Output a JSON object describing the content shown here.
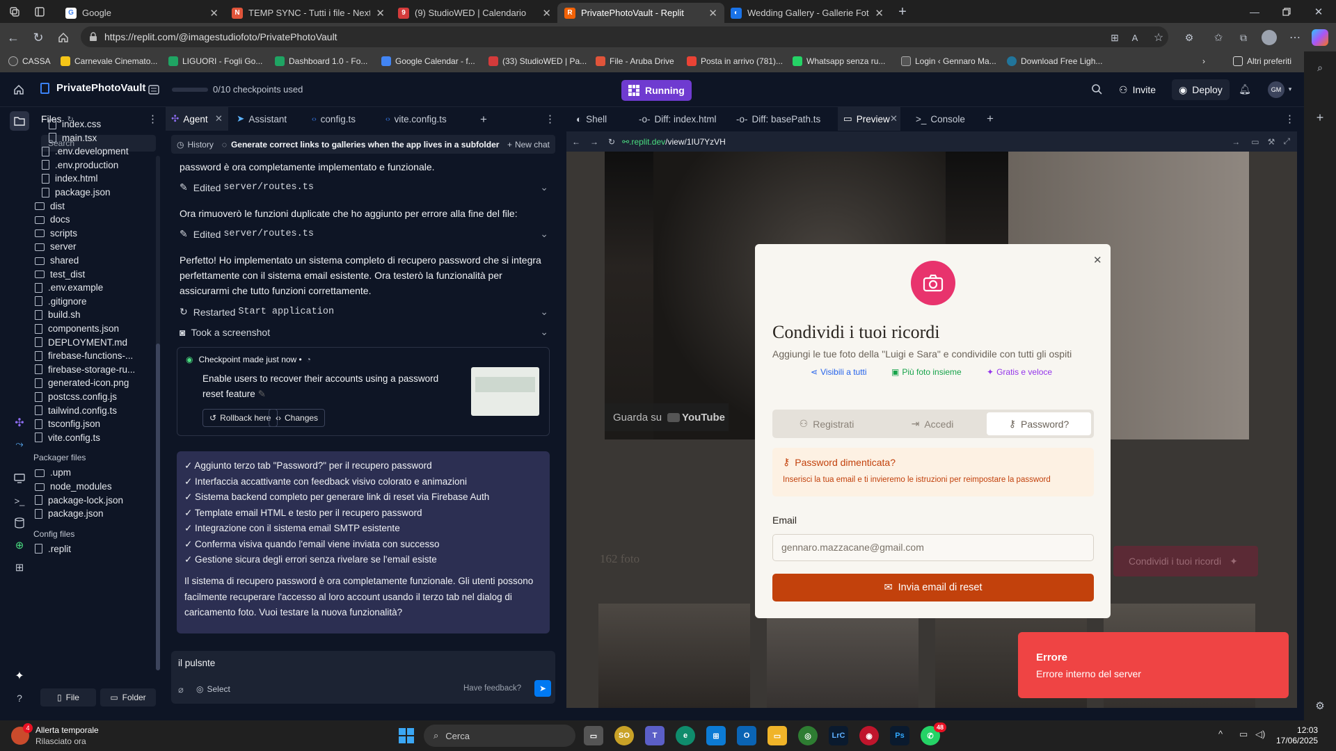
{
  "browser": {
    "tabs": [
      {
        "title": "Google",
        "active": false
      },
      {
        "title": "TEMP SYNC - Tutti i file - Nextclo",
        "active": false
      },
      {
        "title": "(9) StudioWED | Calendario",
        "active": false
      },
      {
        "title": "PrivatePhotoVault - Replit",
        "active": true
      },
      {
        "title": "Wedding Gallery - Gallerie Fotogr",
        "active": false
      }
    ],
    "url": "https://replit.com/@imagestudiofoto/PrivatePhotoVault",
    "bookmarks": [
      "CASSA",
      "Carnevale Cinemato...",
      "LIGUORI - Fogli Go...",
      "Dashboard 1.0 - Fo...",
      "Google Calendar - f...",
      "(33) StudioWED | Pa...",
      "File - Aruba Drive",
      "Posta in arrivo (781)...",
      "Whatsapp senza ru...",
      "Login ‹ Gennaro Ma...",
      "Download Free Ligh..."
    ],
    "bookmarks_other": "Altri preferiti"
  },
  "replit": {
    "project_name": "PrivatePhotoVault",
    "checkpoints": "0/10 checkpoints used",
    "run_status": "Running",
    "invite_label": "Invite",
    "deploy_label": "Deploy",
    "avatar_initials": "GM"
  },
  "files": {
    "title": "Files",
    "search_placeholder": "Search",
    "items": [
      {
        "name": "index.css",
        "type": "file",
        "indent": 2
      },
      {
        "name": "main.tsx",
        "type": "file",
        "indent": 2
      },
      {
        "name": ".env.development",
        "type": "file",
        "indent": 1
      },
      {
        "name": ".env.production",
        "type": "file",
        "indent": 1
      },
      {
        "name": "index.html",
        "type": "file",
        "indent": 1
      },
      {
        "name": "package.json",
        "type": "file",
        "indent": 1
      },
      {
        "name": "dist",
        "type": "folder",
        "indent": 0
      },
      {
        "name": "docs",
        "type": "folder",
        "indent": 0
      },
      {
        "name": "scripts",
        "type": "folder",
        "indent": 0
      },
      {
        "name": "server",
        "type": "folder",
        "indent": 0
      },
      {
        "name": "shared",
        "type": "folder",
        "indent": 0
      },
      {
        "name": "test_dist",
        "type": "folder",
        "indent": 0
      },
      {
        "name": ".env.example",
        "type": "file",
        "indent": 0
      },
      {
        "name": ".gitignore",
        "type": "file",
        "indent": 0
      },
      {
        "name": "build.sh",
        "type": "file",
        "indent": 0
      },
      {
        "name": "components.json",
        "type": "file",
        "indent": 0
      },
      {
        "name": "DEPLOYMENT.md",
        "type": "file",
        "indent": 0
      },
      {
        "name": "firebase-functions-...",
        "type": "file",
        "indent": 0
      },
      {
        "name": "firebase-storage-ru...",
        "type": "file",
        "indent": 0
      },
      {
        "name": "generated-icon.png",
        "type": "file",
        "indent": 0
      },
      {
        "name": "postcss.config.js",
        "type": "file",
        "indent": 0
      },
      {
        "name": "tailwind.config.ts",
        "type": "file",
        "indent": 0
      },
      {
        "name": "tsconfig.json",
        "type": "file",
        "indent": 0
      },
      {
        "name": "vite.config.ts",
        "type": "file",
        "indent": 0
      }
    ],
    "packager_title": "Packager files",
    "packager_items": [
      ".upm",
      "node_modules",
      "package-lock.json",
      "package.json"
    ],
    "config_title": "Config files",
    "config_items": [
      ".replit"
    ],
    "new_file": "File",
    "new_folder": "Folder"
  },
  "agent": {
    "tabs": [
      "Agent",
      "Assistant",
      "config.ts",
      "vite.config.ts"
    ],
    "history_label": "History",
    "chat_title": "Generate correct links to galleries when the app lives in a subfolder",
    "new_chat": "New chat",
    "msg0": "password è ora completamente implementato e funzionale.",
    "tool1": "Edited",
    "tool1_file": "server/routes.ts",
    "msg1": "Ora rimuoverò le funzioni duplicate che ho aggiunto per errore alla fine del file:",
    "tool2": "Edited",
    "tool2_file": "server/routes.ts",
    "msg2": "Perfetto! Ho implementato un sistema completo di recupero password che si integra perfettamente con il sistema email esistente. Ora testerò la funzionalità per assicurarmi che tutto funzioni correttamente.",
    "tool3": "Restarted",
    "tool3_file": "Start application",
    "tool4": "Took a screenshot",
    "checkpoint_header": "Checkpoint made just now •",
    "checkpoint_text": "Enable users to recover their accounts using a password reset feature",
    "rollback": "Rollback here",
    "changes": "Changes",
    "summary": [
      "✓ Aggiunto terzo tab \"Password?\" per il recupero password",
      "✓ Interfaccia accattivante con feedback visivo colorato e animazioni",
      "✓ Sistema backend completo per generare link di reset via Firebase Auth",
      "✓ Template email HTML e testo per il recupero password",
      "✓ Integrazione con il sistema email SMTP esistente",
      "✓ Conferma visiva quando l'email viene inviata con successo",
      "✓ Gestione sicura degli errori senza rivelare se l'email esiste"
    ],
    "summary_para": "Il sistema di recupero password è ora completamente funzionale. Gli utenti possono facilmente recuperare l'accesso al loro account usando il terzo tab nel dialog di caricamento foto. Vuoi testare la nuova funzionalità?",
    "input_value": "il pulsnte",
    "select_label": "Select",
    "feedback": "Have feedback?"
  },
  "preview": {
    "tabs": [
      "Shell",
      "Diff: index.html",
      "Diff: basePath.ts",
      "Preview",
      "Console"
    ],
    "url_prefix": ".replit.dev",
    "url_path": "/view/1IU7YzVH",
    "youtube_text": "Guarda su",
    "youtube_brand": "YouTube",
    "photo_count": "162 foto",
    "share_button": "Condividi i tuoi ricordi",
    "modal": {
      "title": "Condividi i tuoi ricordi",
      "subtitle": "Aggiungi le tue foto della \"Luigi e Sara\" e condividile con tutti gli ospiti",
      "features": [
        "Visibili a tutti",
        "Più foto insieme",
        "Gratis e veloce"
      ],
      "tabs": [
        "Registrati",
        "Accedi",
        "Password?"
      ],
      "info_title": "Password dimenticata?",
      "info_text": "Inserisci la tua email e ti invieremo le istruzioni per reimpostare la password",
      "email_label": "Email",
      "email_value": "gennaro.mazzacane@gmail.com",
      "submit": "Invia email di reset"
    },
    "toast": {
      "title": "Errore",
      "text": "Errore interno del server"
    }
  },
  "taskbar": {
    "weather_title": "Allerta temporale",
    "weather_sub": "Rilasciato ora",
    "weather_badge": "4",
    "search": "Cerca",
    "time": "12:03",
    "date": "17/06/2025",
    "whatsapp_badge": "48"
  },
  "colors": {
    "accent": "#e8336d",
    "submit": "#c2410c",
    "toast": "#ef4444",
    "replit_bg": "#0e1525",
    "running": "#6f3bd0"
  }
}
